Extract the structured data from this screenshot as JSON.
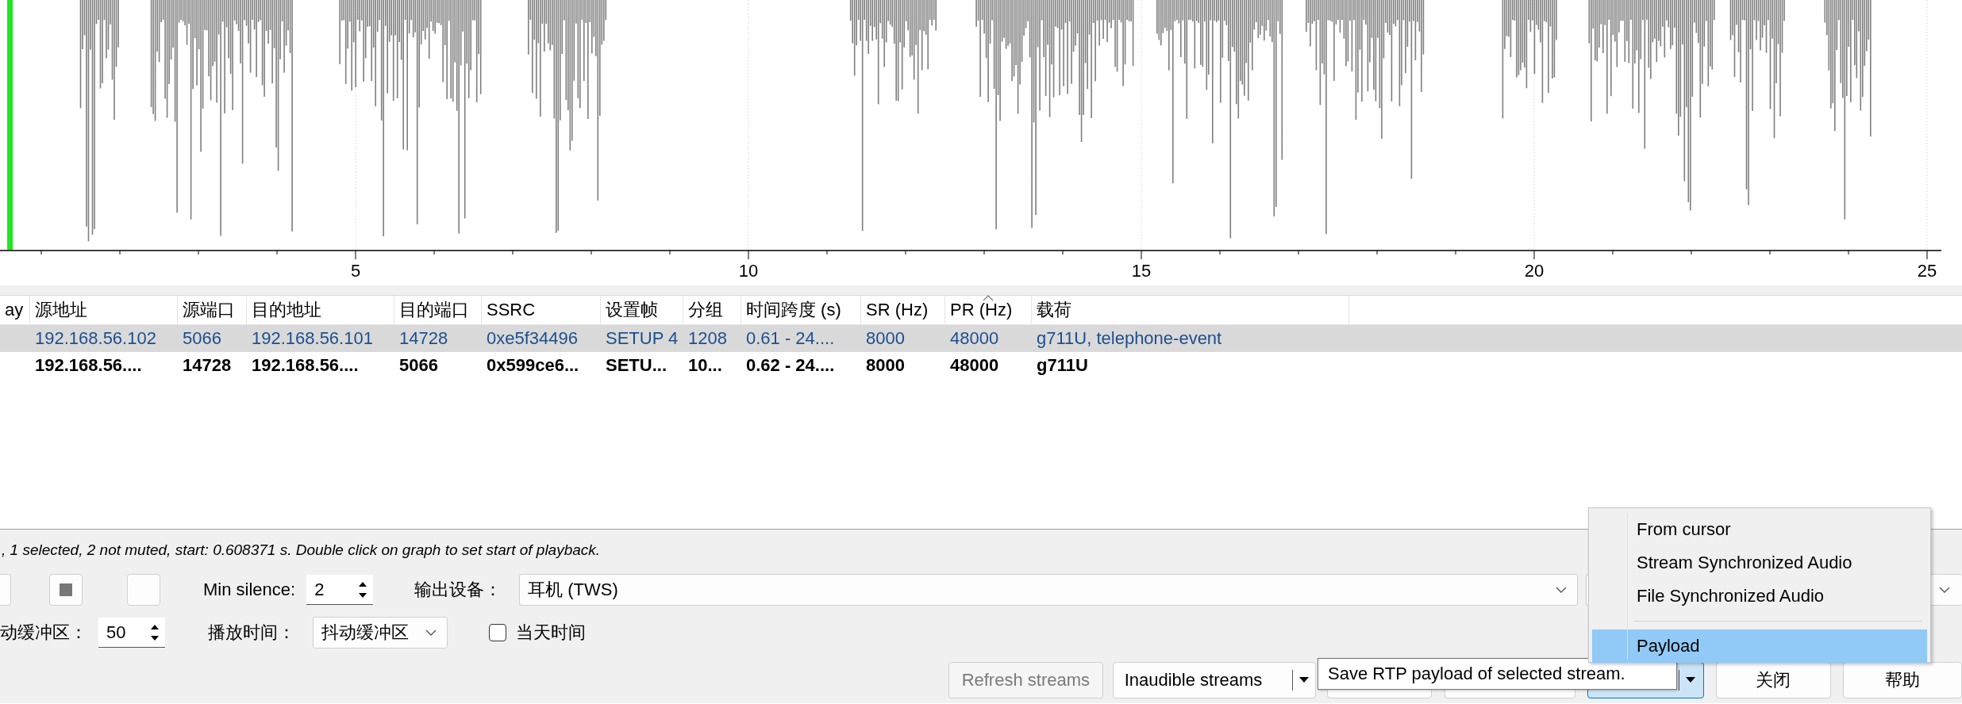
{
  "waveform": {
    "x_axis_labels": [
      "5",
      "10",
      "15",
      "20",
      "25"
    ]
  },
  "streams_table": {
    "columns": [
      {
        "label": "ay",
        "sorted": false
      },
      {
        "label": "源地址",
        "sorted": false
      },
      {
        "label": "源端口",
        "sorted": false
      },
      {
        "label": "目的地址",
        "sorted": false
      },
      {
        "label": "目的端口",
        "sorted": false
      },
      {
        "label": "SSRC",
        "sorted": false
      },
      {
        "label": "设置帧",
        "sorted": false
      },
      {
        "label": "分组",
        "sorted": false
      },
      {
        "label": "时间跨度 (s)",
        "sorted": false
      },
      {
        "label": "SR (Hz)",
        "sorted": false
      },
      {
        "label": "PR (Hz)",
        "sorted": true
      },
      {
        "label": "载荷",
        "sorted": false
      }
    ],
    "rows": [
      {
        "selected": true,
        "emphasized": false,
        "cells": [
          "",
          "192.168.56.102",
          "5066",
          "192.168.56.101",
          "14728",
          "0xe5f34496",
          "SETUP 4",
          "1208",
          "0.61 - 24....",
          "8000",
          "48000",
          "g711U, telephone-event"
        ]
      },
      {
        "selected": false,
        "emphasized": true,
        "cells": [
          "",
          "192.168.56....",
          "14728",
          "192.168.56....",
          "5066",
          "0x599ce6...",
          "SETU...",
          "10...",
          "0.62 - 24....",
          "8000",
          "48000",
          "g711U"
        ]
      }
    ]
  },
  "status_text": ", 1 selected, 2 not muted, start: 0.608371 s. Double click on graph to set start of playback.",
  "controls": {
    "min_silence_label": "Min silence:",
    "min_silence": "2",
    "output_device_label": "输出设备：",
    "output_device": "耳机 (TWS)",
    "jitter_buffer_label": "动缓冲区：",
    "jitter_buffer": "50",
    "playback_timing_label": "播放时间：",
    "playback_timing": "抖动缓冲区",
    "time_of_day": {
      "label": "当天时间",
      "checked": false
    }
  },
  "buttons": {
    "refresh": {
      "label": "Refresh streams",
      "disabled": true
    },
    "inaudible": "Inaudible streams",
    "close": "关闭",
    "help": "帮助"
  },
  "tooltip": "Save RTP payload of selected stream.",
  "export_menu": [
    {
      "label": "From cursor",
      "selected": false
    },
    {
      "label": "Stream Synchronized Audio",
      "selected": false
    },
    {
      "label": "File Synchronized Audio",
      "selected": false
    },
    {
      "kind": "separator"
    },
    {
      "label": "Payload",
      "selected": true
    }
  ]
}
